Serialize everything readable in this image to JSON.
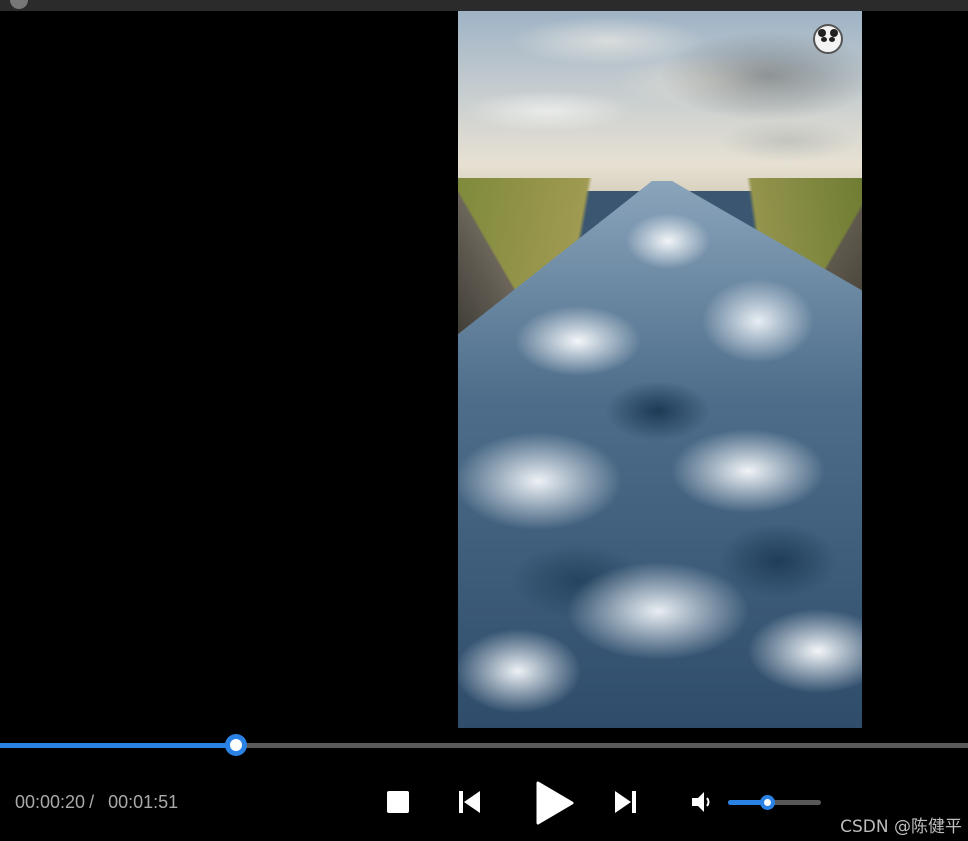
{
  "player": {
    "current_time": "00:00:20",
    "separator": "/",
    "total_time": "00:01:51",
    "progress_fraction": 0.244,
    "volume_fraction": 0.42,
    "accent_color": "#2a82e4"
  },
  "controls": {
    "stop": "stop-icon",
    "previous": "skip-previous-icon",
    "play": "play-icon",
    "next": "skip-next-icon",
    "volume": "volume-icon"
  },
  "watermark": {
    "credit": "CSDN @陈健平"
  }
}
